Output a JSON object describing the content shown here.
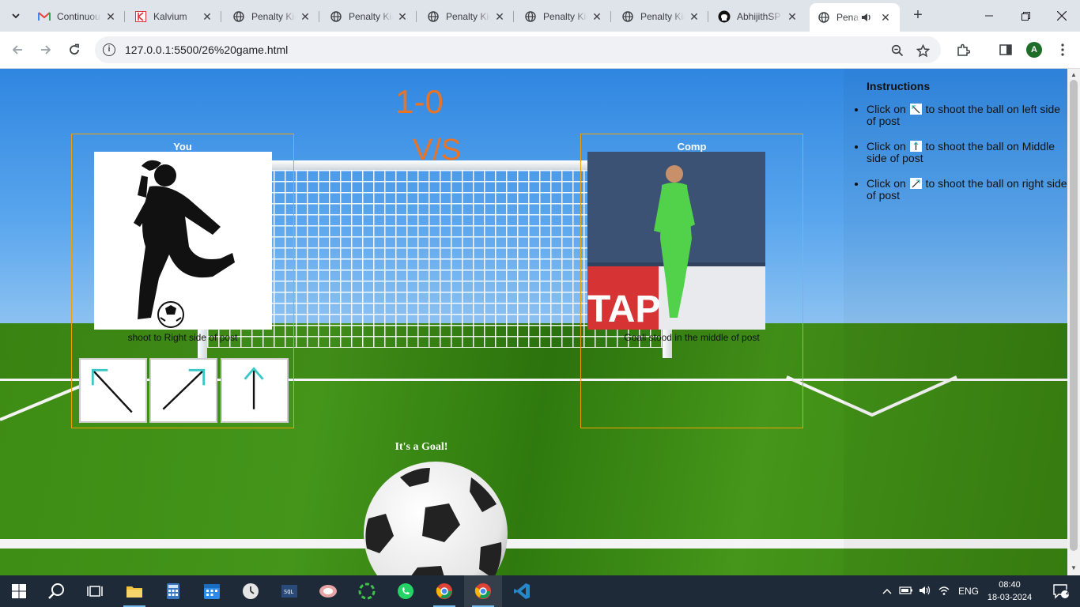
{
  "browser": {
    "tabs": [
      {
        "title": "Continuous",
        "icon": "gmail-icon"
      },
      {
        "title": "Kalvium",
        "icon": "kalvium-icon"
      },
      {
        "title": "Penalty Kick",
        "icon": "globe-icon"
      },
      {
        "title": "Penalty Kick",
        "icon": "globe-icon"
      },
      {
        "title": "Penalty Kick",
        "icon": "globe-icon"
      },
      {
        "title": "Penalty Kick",
        "icon": "globe-icon"
      },
      {
        "title": "Penalty Kick",
        "icon": "globe-icon"
      },
      {
        "title": "AbhijithSP",
        "icon": "github-icon"
      },
      {
        "title": "Penalty",
        "icon": "globe-icon",
        "active": true
      }
    ],
    "url": "127.0.0.1:5500/26%20game.html",
    "profile_initial": "A"
  },
  "game": {
    "score": "1-0",
    "vs": "V/S",
    "player_panel": {
      "title": "You",
      "caption": "shoot to Right side of post"
    },
    "comp_panel": {
      "title": "Comp",
      "caption": "Goali stood in the middle of post"
    },
    "result": "It's a Goal!"
  },
  "instructions": {
    "title": "Instructions",
    "items": [
      {
        "prefix": "Click on",
        "suffix": "to shoot the ball on left side of post"
      },
      {
        "prefix": "Click on",
        "suffix": "to shoot the ball on Middle side of post"
      },
      {
        "prefix": "Click on",
        "suffix": "to shoot the ball on right side of post"
      }
    ]
  },
  "taskbar": {
    "language": "ENG",
    "time": "08:40",
    "date": "18-03-2024",
    "notifications": "2"
  },
  "colors": {
    "accent_orange": "#e87427",
    "panel_border": "#f2a200"
  }
}
